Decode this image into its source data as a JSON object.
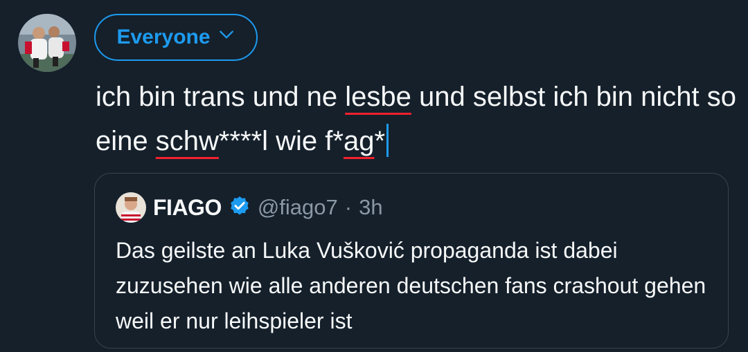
{
  "composer": {
    "audience_label": "Everyone",
    "text_part1": "ich bin trans und ne ",
    "text_flag1": "lesbe",
    "text_part2": " und selbst ich bin nicht so eine ",
    "text_flag2": "schw",
    "text_part3": "****l wie f*",
    "text_flag3": "ag",
    "text_part4": "*"
  },
  "quoted_post": {
    "display_name": "FIAGO",
    "handle": "@fiago7",
    "separator": "·",
    "time": "3h",
    "text": "Das geilste an Luka Vušković propaganda ist dabei zuzusehen wie alle anderen deutschen fans crashout gehen weil er nur leihspieler ist"
  },
  "colors": {
    "background": "#15202b",
    "accent": "#1d9bf0",
    "spellcheck": "#f4212e",
    "border": "#38444d",
    "secondary_text": "#8b98a5"
  },
  "icons": {
    "audience_chevron": "chevron-down-icon",
    "verified": "verified-badge-icon"
  }
}
